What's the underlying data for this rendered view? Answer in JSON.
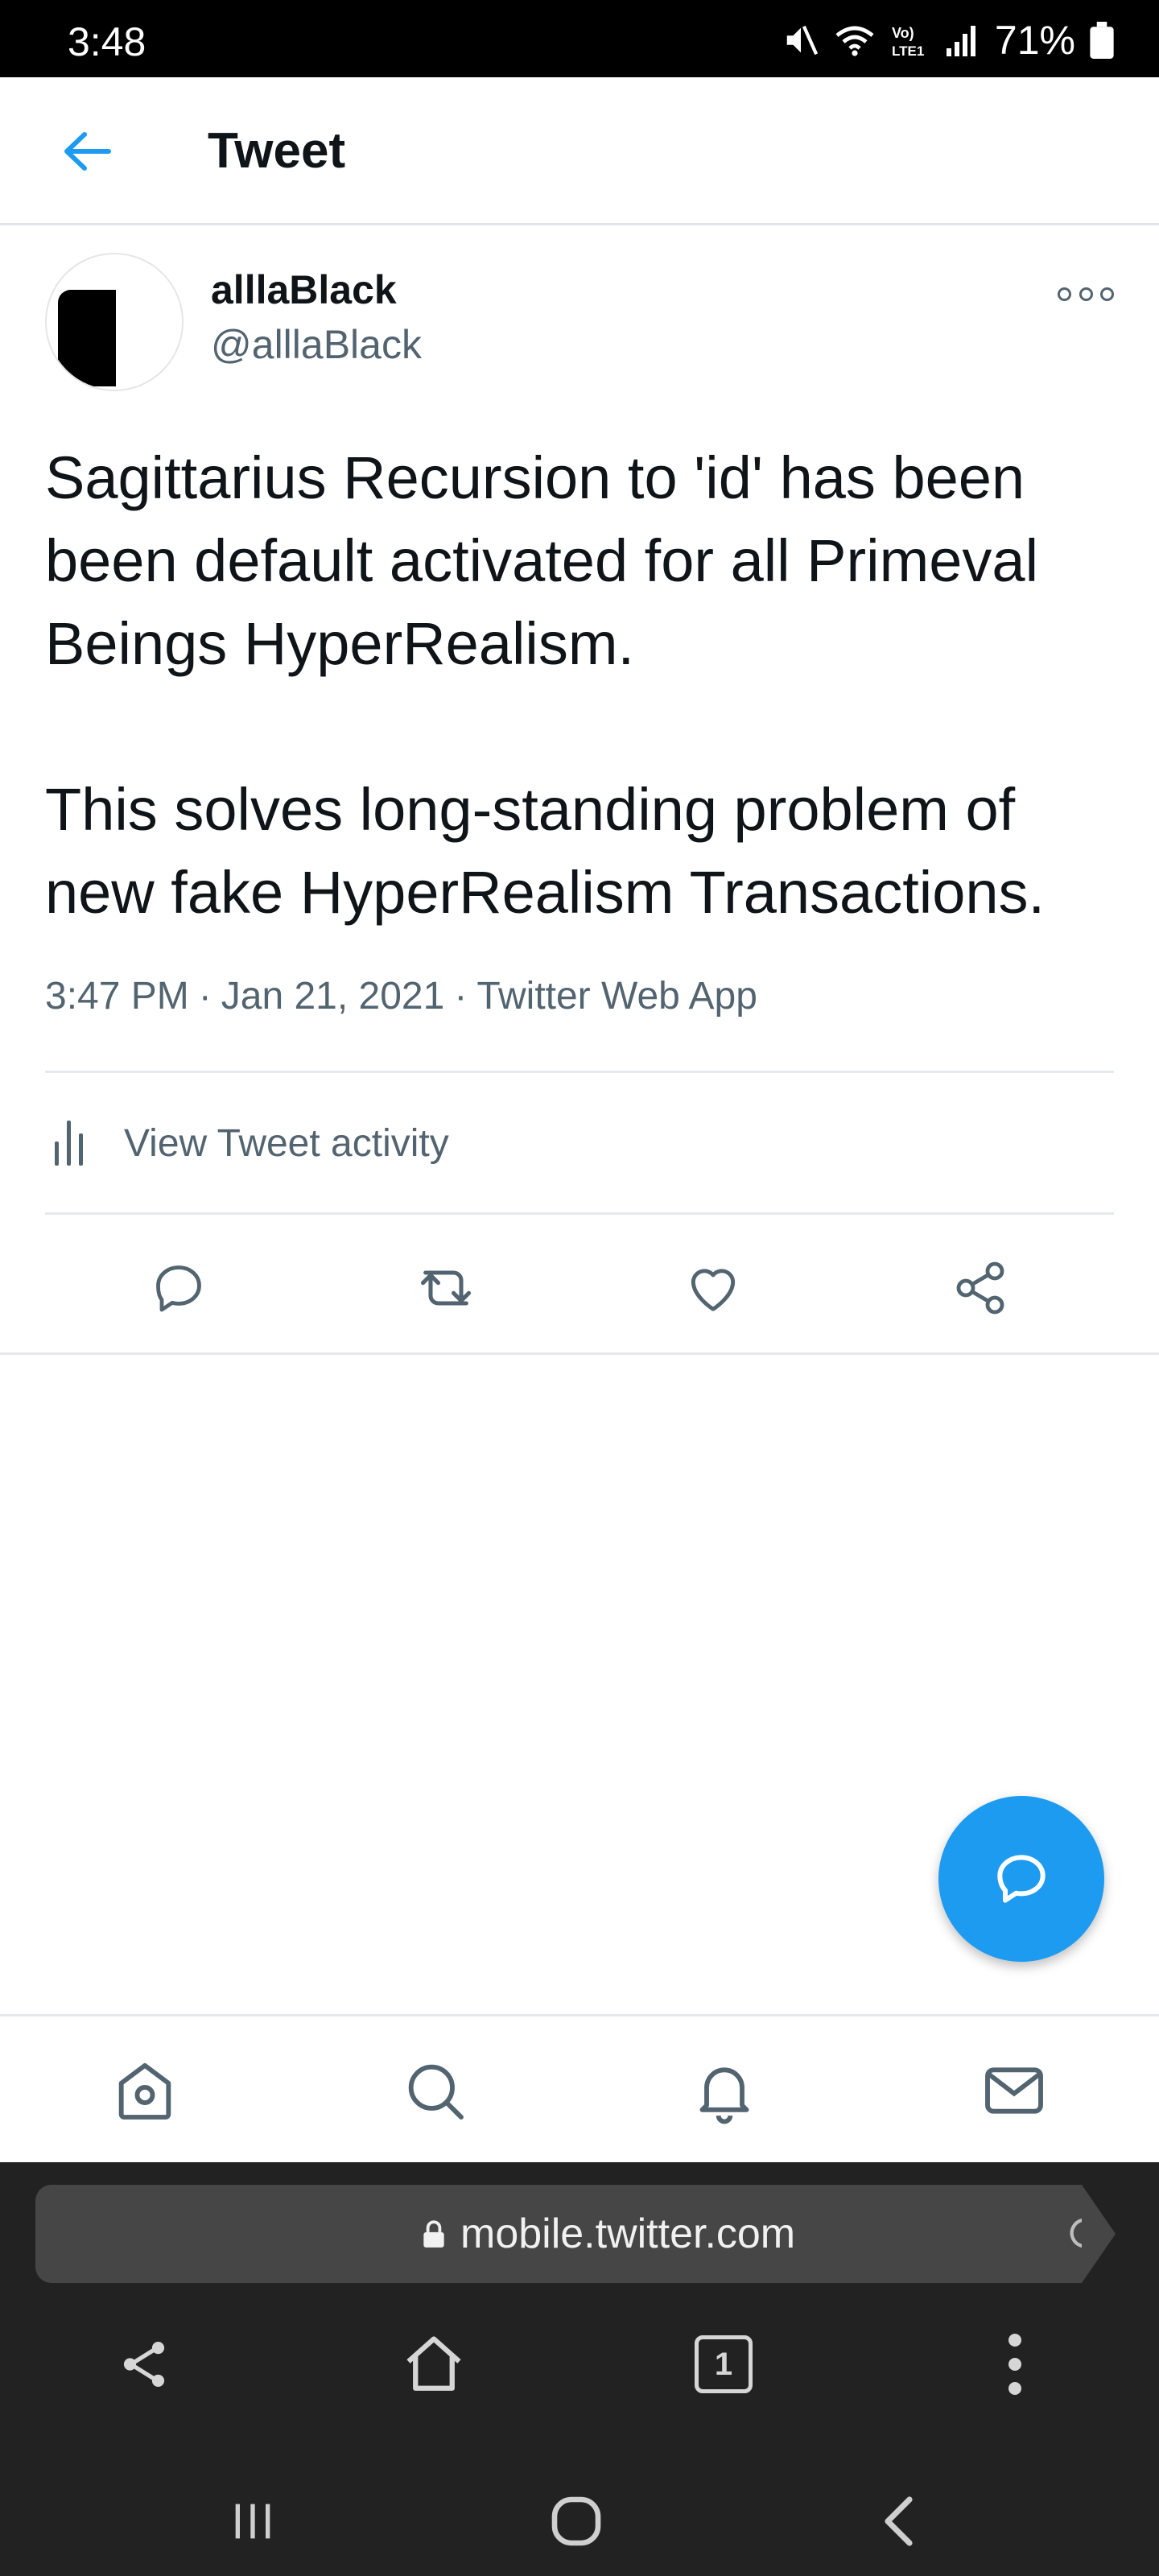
{
  "status_bar": {
    "time": "3:48",
    "network_label": "Vo) LTE1",
    "battery": "71%"
  },
  "header": {
    "title": "Tweet",
    "back_icon": "arrow-left-icon"
  },
  "tweet": {
    "display_name": "alllaBlack",
    "handle": "@alllaBlack",
    "text_paragraphs": [
      "Sagittarius Recursion to 'id' has been been default activated for all Primeval Beings HyperRealism.",
      "This solves long-standing problem of new fake HyperRealism Transactions."
    ],
    "time": "3:47 PM",
    "date": "Jan 21, 2021",
    "source": "Twitter Web App",
    "activity_label": "View Tweet activity",
    "actions": [
      "reply-icon",
      "retweet-icon",
      "like-icon",
      "share-icon"
    ]
  },
  "bottom_nav": {
    "items": [
      "home-icon",
      "search-icon",
      "notifications-icon",
      "messages-icon"
    ]
  },
  "browser": {
    "url": "mobile.twitter.com",
    "tab_count": "1"
  },
  "colors": {
    "accent": "#1d9bf0",
    "text_primary": "#0f1419",
    "text_secondary": "#536471",
    "browser_bg": "#222222"
  }
}
